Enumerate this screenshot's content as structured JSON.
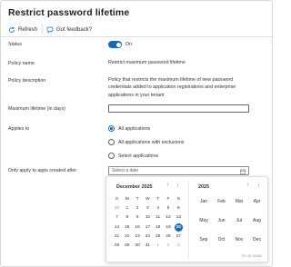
{
  "page": {
    "title": "Restrict password lifetime"
  },
  "toolbar": {
    "refresh_label": "Refresh",
    "feedback_label": "Got feedback?"
  },
  "fields": {
    "status_label": "Status",
    "status_value": "On",
    "policy_name_label": "Policy name",
    "policy_name_value": "Restrict maximum password lifetime",
    "policy_desc_label": "Policy description",
    "policy_desc_value": "Policy that restricts the maximum lifetime of new password credentials added to application registrations and enterprise applications in your tenant",
    "max_lifetime_label": "Maximum lifetime (in days)",
    "max_lifetime_value": "",
    "applies_to_label": "Applies to",
    "apply_only_label": "Only apply to apps created after",
    "date_placeholder": "Select a date"
  },
  "radios": [
    {
      "label": "All applications",
      "selected": true
    },
    {
      "label": "All applications with exclusions",
      "selected": false
    },
    {
      "label": "Select applications",
      "selected": false
    }
  ],
  "calendar": {
    "month_title": "December 2025",
    "weekdays": [
      "S",
      "M",
      "T",
      "W",
      "T",
      "F",
      "S"
    ],
    "weeks": [
      [
        "30",
        "1",
        "2",
        "3",
        "4",
        "5",
        "6"
      ],
      [
        "7",
        "8",
        "9",
        "10",
        "11",
        "12",
        "13"
      ],
      [
        "14",
        "15",
        "16",
        "17",
        "18",
        "19",
        "20"
      ],
      [
        "21",
        "22",
        "23",
        "24",
        "25",
        "26",
        "27"
      ],
      [
        "28",
        "29",
        "30",
        "31",
        "1",
        "2",
        "3"
      ]
    ],
    "today": "20",
    "year_title": "2025",
    "months": [
      "Jan",
      "Feb",
      "Mar",
      "Apr",
      "May",
      "Jun",
      "Jul",
      "Aug",
      "Sep",
      "Oct",
      "Nov",
      "Dec"
    ],
    "go_to_today": "Go to today"
  },
  "colors": {
    "accent": "#0f6cbd",
    "error": "#d13438"
  }
}
